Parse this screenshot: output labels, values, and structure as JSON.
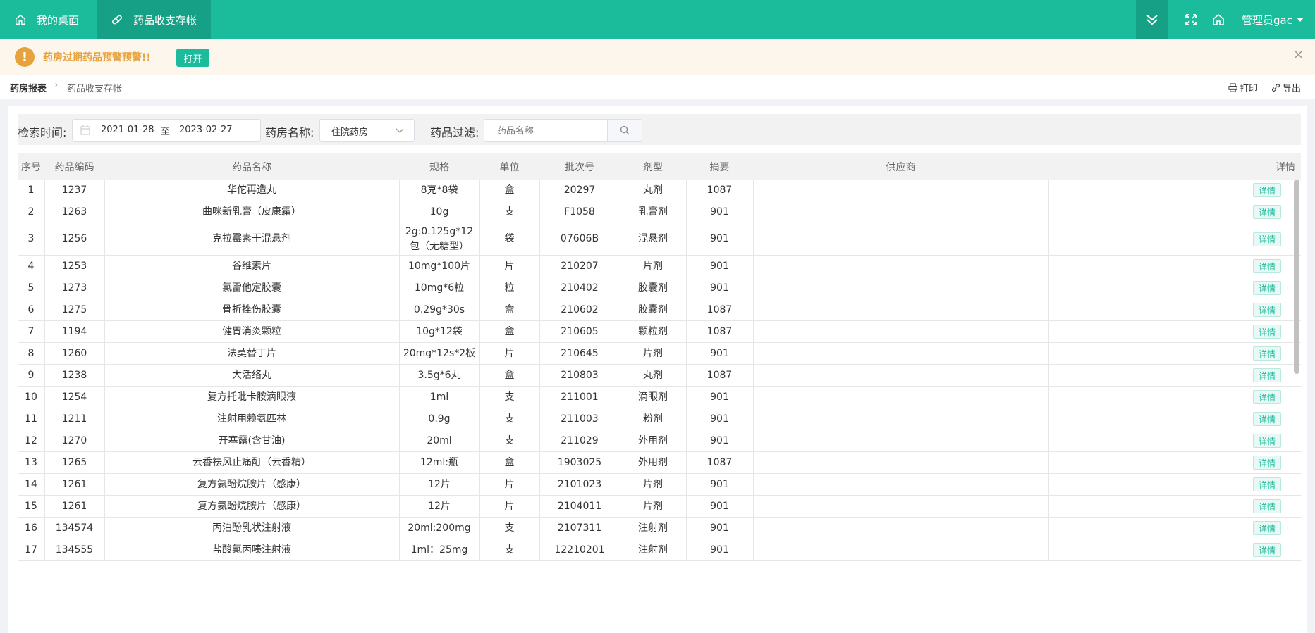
{
  "topbar": {
    "home_tab": "我的桌面",
    "active_tab": "药品收支存帐",
    "user": "管理员gac"
  },
  "alert": {
    "message": "药房过期药品预警预警!!",
    "open_button": "打开",
    "close": "×"
  },
  "breadcrumb": {
    "parent": "药房报表",
    "separator": "›",
    "current": "药品收支存帐",
    "print": "打印",
    "export": "导出"
  },
  "filter": {
    "time_label": "检索时间:",
    "start_date": "2021-01-28",
    "range_sep": "至",
    "end_date": "2023-02-27",
    "pharmacy_label": "药房名称:",
    "pharmacy_value": "住院药房",
    "drug_label": "药品过滤:",
    "drug_placeholder": "药品名称"
  },
  "table": {
    "headers": [
      "序号",
      "药品编码",
      "药品名称",
      "规格",
      "单位",
      "批次号",
      "剂型",
      "摘要",
      "供应商",
      "详情"
    ],
    "detail_label": "详情",
    "rows": [
      [
        "1",
        "1237",
        "华佗再造丸",
        "8克*8袋",
        "盒",
        "20297",
        "丸剂",
        "1087",
        ""
      ],
      [
        "2",
        "1263",
        "曲咪新乳膏（皮康霜）",
        "10g",
        "支",
        "F1058",
        "乳膏剂",
        "901",
        ""
      ],
      [
        "3",
        "1256",
        "克拉霉素干混悬剂",
        "2g:0.125g*12包（无糖型）",
        "袋",
        "07606B",
        "混悬剂",
        "901",
        ""
      ],
      [
        "4",
        "1253",
        "谷维素片",
        "10mg*100片",
        "片",
        "210207",
        "片剂",
        "901",
        ""
      ],
      [
        "5",
        "1273",
        "氯雷他定胶囊",
        "10mg*6粒",
        "粒",
        "210402",
        "胶囊剂",
        "901",
        ""
      ],
      [
        "6",
        "1275",
        "骨折挫伤胶囊",
        "0.29g*30s",
        "盒",
        "210602",
        "胶囊剂",
        "1087",
        ""
      ],
      [
        "7",
        "1194",
        "健胃消炎颗粒",
        "10g*12袋",
        "盒",
        "210605",
        "颗粒剂",
        "1087",
        ""
      ],
      [
        "8",
        "1260",
        "法莫替丁片",
        "20mg*12s*2板",
        "片",
        "210645",
        "片剂",
        "901",
        ""
      ],
      [
        "9",
        "1238",
        "大活络丸",
        "3.5g*6丸",
        "盒",
        "210803",
        "丸剂",
        "1087",
        ""
      ],
      [
        "10",
        "1254",
        "复方托吡卡胺滴眼液",
        "1ml",
        "支",
        "211001",
        "滴眼剂",
        "901",
        ""
      ],
      [
        "11",
        "1211",
        "注射用赖氨匹林",
        "0.9g",
        "支",
        "211003",
        "粉剂",
        "901",
        ""
      ],
      [
        "12",
        "1270",
        "开塞露(含甘油)",
        "20ml",
        "支",
        "211029",
        "外用剂",
        "901",
        ""
      ],
      [
        "13",
        "1265",
        "云香祛风止痛酊（云香精）",
        "12ml:瓶",
        "盒",
        "1903025",
        "外用剂",
        "1087",
        ""
      ],
      [
        "14",
        "1261",
        "复方氨酚烷胺片（感康）",
        "12片",
        "片",
        "2101023",
        "片剂",
        "901",
        ""
      ],
      [
        "15",
        "1261",
        "复方氨酚烷胺片（感康）",
        "12片",
        "片",
        "2104011",
        "片剂",
        "901",
        ""
      ],
      [
        "16",
        "134574",
        "丙泊酚乳状注射液",
        "20ml:200mg",
        "支",
        "2107311",
        "注射剂",
        "901",
        ""
      ],
      [
        "17",
        "134555",
        "盐酸氯丙嗪注射液",
        "1ml：25mg",
        "支",
        "12210201",
        "注射剂",
        "901",
        ""
      ]
    ]
  },
  "colors": {
    "primary": "#1abc9c",
    "primary_dark": "#16a085",
    "warning": "#e6a23c"
  }
}
